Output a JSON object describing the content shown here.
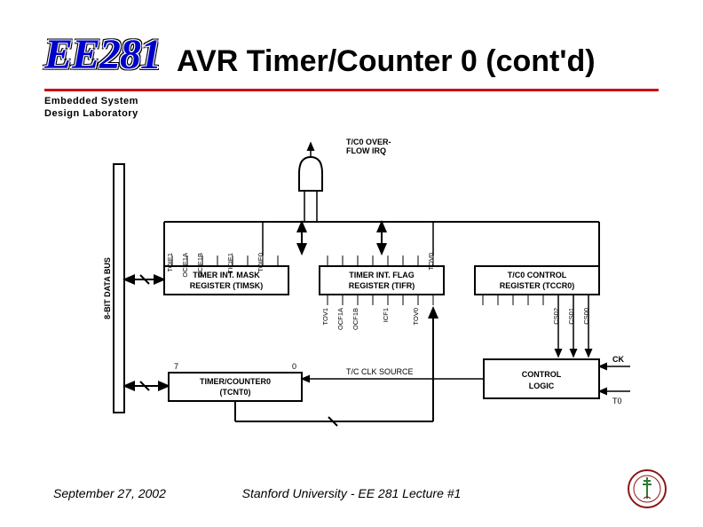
{
  "header": {
    "course_code": "EE281",
    "title": "AVR Timer/Counter 0 (cont'd)",
    "subtitle_line1": "Embedded System",
    "subtitle_line2": "Design Laboratory"
  },
  "diagram": {
    "top_signal_line1": "T/C0 OVER-",
    "top_signal_line2": "FLOW IRQ",
    "bus_label": "8-BIT DATA BUS",
    "timsk": {
      "line1": "TIMER INT. MASK",
      "line2": "REGISTER (TIMSK)",
      "bits": [
        "TOIE1",
        "OCIE1A",
        "OCIE1B",
        "–",
        "TICIE1",
        "–",
        "TOIE0",
        "–"
      ]
    },
    "tifr": {
      "line1": "TIMER INT. FLAG",
      "line2": "REGISTER (TIFR)",
      "top_bits": [
        "–",
        "–",
        "–",
        "–",
        "–",
        "–",
        "–",
        "TOV0"
      ],
      "bottom_bits": [
        "TOV1",
        "OCF1A",
        "OCF1B",
        "–",
        "ICF1",
        "–",
        "TOV0",
        "–"
      ]
    },
    "tccr0": {
      "line1": "T/C0 CONTROL",
      "line2": "REGISTER (TCCR0)",
      "bits": [
        "–",
        "–",
        "–",
        "–",
        "–",
        "CS02",
        "CS01",
        "CS00"
      ]
    },
    "tcnt0": {
      "line1": "TIMER/COUNTER0",
      "line2": "(TCNT0)",
      "msb": "7",
      "lsb": "0"
    },
    "control_logic": "CONTROL\nLOGIC",
    "clk_source": "T/C CLK SOURCE",
    "inputs": {
      "ck": "CK",
      "t0": "T0"
    }
  },
  "footer": {
    "date": "September 27, 2002",
    "center": "Stanford University - EE 281 Lecture #1"
  }
}
